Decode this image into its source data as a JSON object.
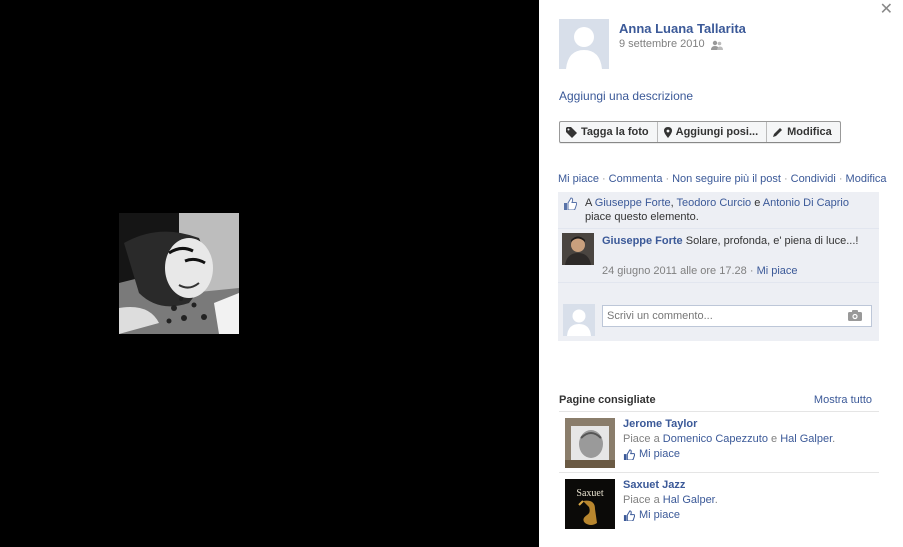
{
  "owner": {
    "name": "Anna Luana Tallarita",
    "date": "9 settembre 2010",
    "add_description": "Aggiungi una descrizione"
  },
  "actions": {
    "tag": "Tagga la foto",
    "location": "Aggiungi posi...",
    "edit": "Modifica"
  },
  "feedback_links": {
    "like": "Mi piace",
    "comment": "Commenta",
    "unfollow": "Non seguire più il post",
    "share": "Condividi",
    "edit": "Modifica",
    "separator": "·"
  },
  "likes": {
    "prefix": "A",
    "people": [
      "Giuseppe Forte",
      "Teodoro Curcio",
      "Antonio Di Caprio"
    ],
    "sep_comma": ",",
    "sep_and": "e",
    "suffix": "piace questo elemento."
  },
  "comment": {
    "author": "Giuseppe Forte",
    "text": "Solare, profonda, e' piena di luce...!",
    "time": "24 giugno 2011 alle ore 17.28",
    "separator": "·",
    "like": "Mi piace"
  },
  "composer": {
    "placeholder": "Scrivi un commento..."
  },
  "recommended": {
    "title": "Pagine consigliate",
    "see_all": "Mostra tutto",
    "like_label": "Mi piace",
    "likes_prefix": "Piace a",
    "items": [
      {
        "name": "Jerome Taylor",
        "liked_by": [
          "Domenico Capezzuto",
          "Hal Galper"
        ],
        "and": "e",
        "end": "."
      },
      {
        "name": "Saxuet Jazz",
        "liked_by": [
          "Hal Galper"
        ],
        "end": ".",
        "thumb_text": "Saxuet"
      }
    ]
  },
  "colors": {
    "link": "#3b5998",
    "ufi_background": "#edeff4",
    "stage_background": "#000000"
  }
}
